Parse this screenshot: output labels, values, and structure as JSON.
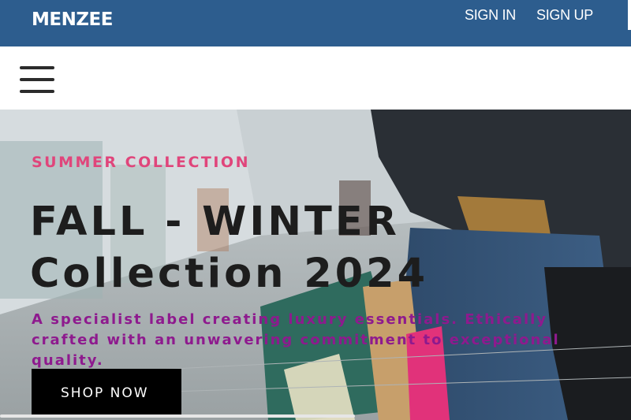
{
  "header": {
    "logo": "MENZEE",
    "sign_in": "SIGN IN",
    "sign_up": "SIGN UP",
    "background_color": "#2d5d8e"
  },
  "nav": {
    "menu_icon": "hamburger-menu-icon"
  },
  "hero": {
    "subtitle": "SUMMER COLLECTION",
    "title_line1": "FALL - WINTER",
    "title_line2": "Collection 2024",
    "description": "A specialist label creating luxury essentials. Ethically crafted with an unwavering commitment to exceptional quality.",
    "cta_label": "SHOP NOW",
    "subtitle_color": "#e0457b",
    "description_color": "#8e1a8e"
  }
}
